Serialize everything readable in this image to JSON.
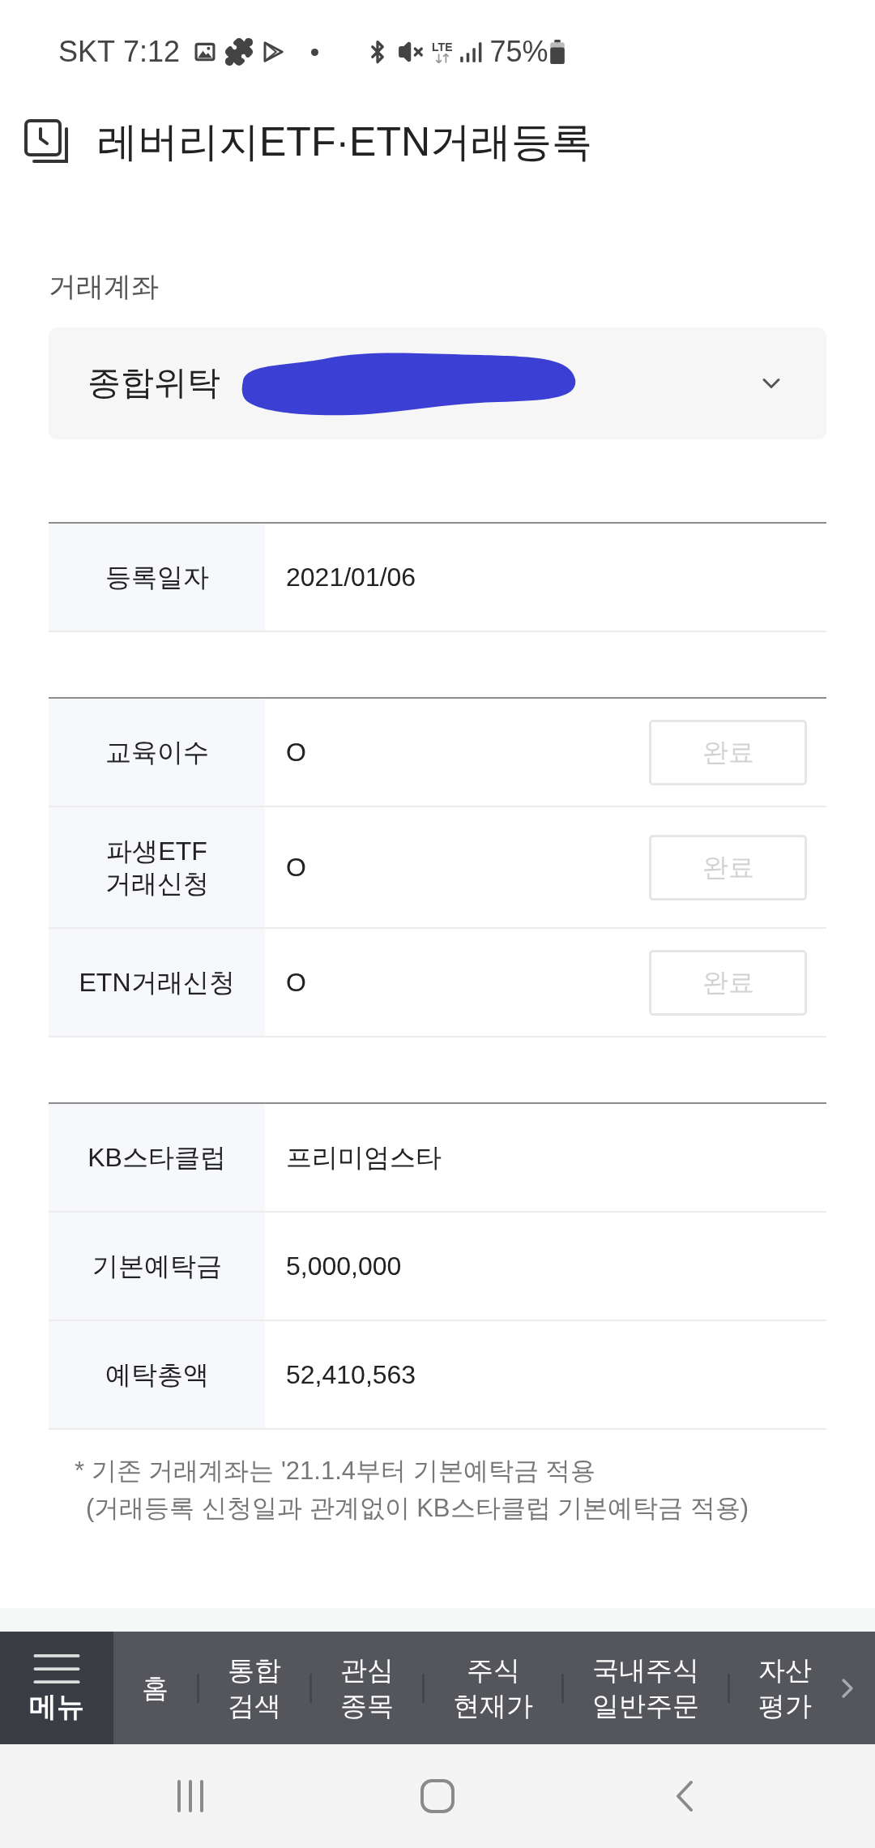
{
  "status_bar": {
    "carrier": "SKT",
    "time": "7:12",
    "network": "LTE",
    "battery": "75%"
  },
  "header": {
    "title": "레버리지ETF·ETN거래등록"
  },
  "account": {
    "label": "거래계좌",
    "type": "종합위탁"
  },
  "sections": [
    {
      "rows": [
        {
          "label": "등록일자",
          "value": "2021/01/06"
        }
      ]
    },
    {
      "rows": [
        {
          "label": "교육이수",
          "value": "O",
          "button": {
            "label": "완료",
            "disabled": true
          }
        },
        {
          "label": "파생ETF\n거래신청",
          "value": "O",
          "button": {
            "label": "완료",
            "disabled": true
          }
        },
        {
          "label": "ETN거래신청",
          "value": "O",
          "button": {
            "label": "완료",
            "disabled": true
          }
        }
      ]
    },
    {
      "rows": [
        {
          "label": "KB스타클럽",
          "value": "프리미엄스타"
        },
        {
          "label": "기본예탁금",
          "value": "5,000,000"
        },
        {
          "label": "예탁총액",
          "value": "52,410,563"
        }
      ]
    }
  ],
  "note": "* 기존 거래계좌는 '21.1.4부터 기본예탁금 적용\n(거래등록 신청일과 관계없이 KB스타클럽 기본예탁금 적용)",
  "bottom_nav": {
    "items": [
      {
        "label": "메뉴",
        "kind": "menu"
      },
      {
        "label": "홈",
        "kind": "link"
      },
      {
        "label": "통합\n검색",
        "kind": "link"
      },
      {
        "label": "관심\n종목",
        "kind": "link"
      },
      {
        "label": "주식\n현재가",
        "kind": "link"
      },
      {
        "label": "국내주식\n일반주문",
        "kind": "link"
      },
      {
        "label": "자산\n평가",
        "kind": "link"
      }
    ]
  }
}
